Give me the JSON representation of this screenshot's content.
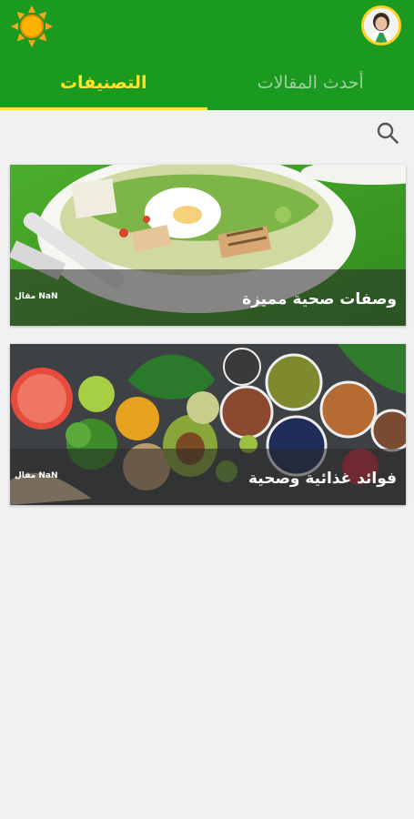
{
  "tabs": [
    {
      "label": "التصنيفات",
      "active": true
    },
    {
      "label": "أحدث المقالات",
      "active": false
    }
  ],
  "icons": {
    "menu": "sun-icon",
    "profile": "avatar",
    "search": "search-icon"
  },
  "colors": {
    "appbar": "#1a9a1f",
    "accent": "#ffe32a",
    "background": "#f1f1f1"
  },
  "categories": [
    {
      "title": "وصفات صحية مميزة",
      "count_label": "NaN مقال"
    },
    {
      "title": "فوائد غذائية وصحية",
      "count_label": "NaN مقال"
    }
  ]
}
